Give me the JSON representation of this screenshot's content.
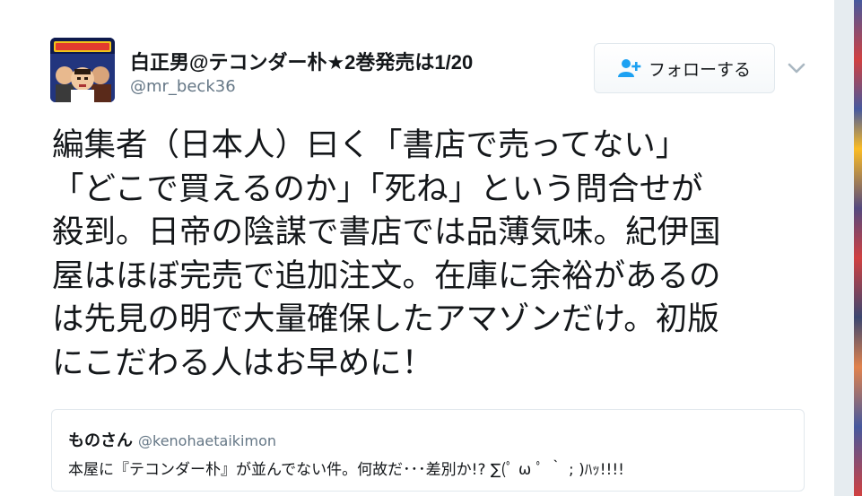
{
  "author": {
    "name": "白正男@テコンダー朴★2巻発売は1/20",
    "handle": "@mr_beck36",
    "avatar_icon": "avatar-image"
  },
  "follow_button": {
    "label": "フォローする",
    "icon": "add-user-icon",
    "accent": "#1da1f2"
  },
  "more_menu": {
    "icon": "chevron-down-icon"
  },
  "tweet": {
    "lines": [
      "編集者（日本人）曰く「書店で売ってない」",
      "「どこで買えるのか」「死ね」という問合せが",
      "殺到。日帝の陰謀で書店では品薄気味。紀伊国",
      "屋はほぼ完売で追加注文。在庫に余裕があるの",
      "は先見の明で大量確保したアマゾンだけ。初版",
      "にこだわる人はお早めに！"
    ]
  },
  "quoted_tweet": {
    "name": "ものさん",
    "handle": "@kenohaetaikimon",
    "text": "本屋に『テコンダー朴』が並んでない件。何故だ･･･差別か!? ∑(ﾟ ω ﾟ ｀ ; )ﾊｯ!!!!"
  },
  "colors": {
    "text": "#14171a",
    "secondary_text": "#657786",
    "border": "#e1e8ed"
  }
}
